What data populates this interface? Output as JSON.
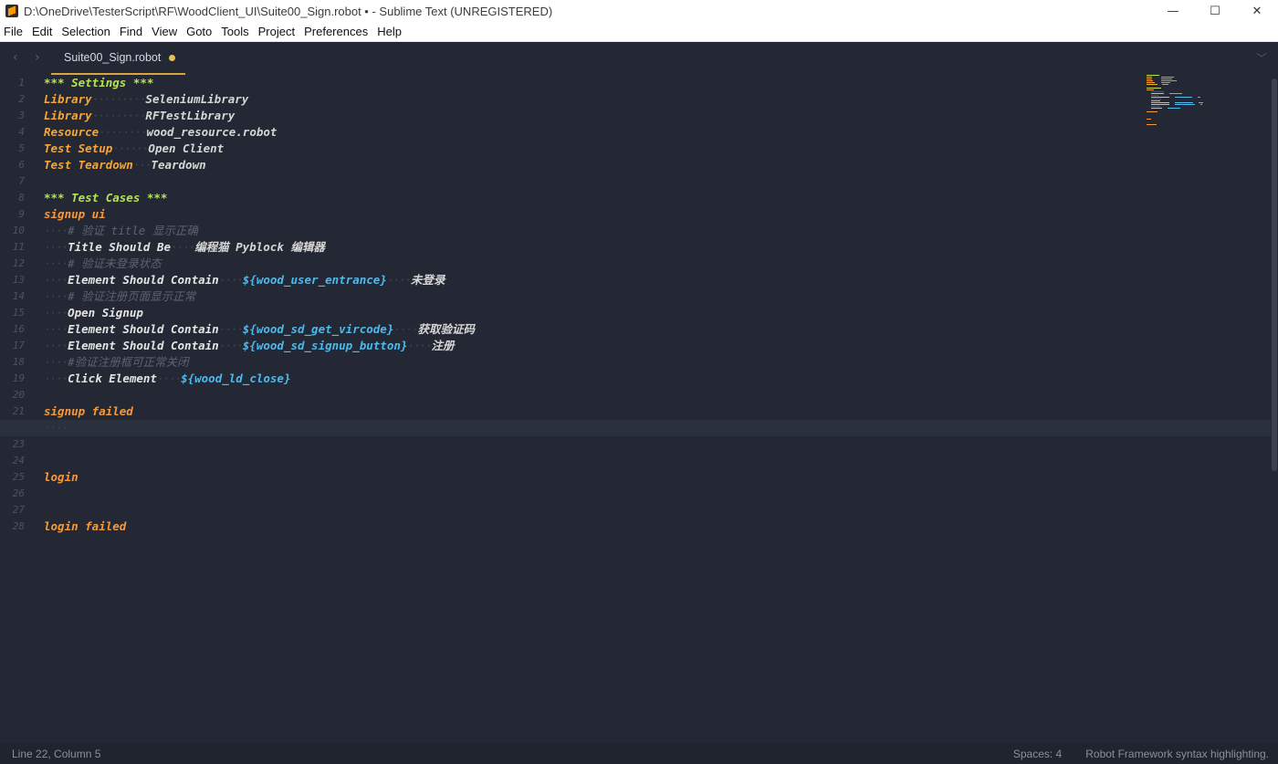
{
  "window": {
    "title": "D:\\OneDrive\\TesterScript\\RF\\WoodClient_UI\\Suite00_Sign.robot • - Sublime Text (UNREGISTERED)",
    "minimize": "—",
    "maximize": "☐",
    "close": "✕"
  },
  "menu": [
    "File",
    "Edit",
    "Selection",
    "Find",
    "View",
    "Goto",
    "Tools",
    "Project",
    "Preferences",
    "Help"
  ],
  "tab": {
    "label": "Suite00_Sign.robot",
    "dirty_color": "#e8c156",
    "accent_color": "#d9a441"
  },
  "nav": {
    "back": "‹",
    "forward": "›",
    "tab_menu": "﹀"
  },
  "editor": {
    "line_numbers": [
      "1",
      "2",
      "3",
      "4",
      "5",
      "6",
      "7",
      "8",
      "9",
      "10",
      "11",
      "12",
      "13",
      "14",
      "15",
      "16",
      "17",
      "18",
      "19",
      "20",
      "21",
      "22",
      "23",
      "24",
      "25",
      "26",
      "27",
      "28"
    ],
    "current_line": 22,
    "lines": [
      [
        {
          "c": "hdr",
          "t": "*** Settings ***"
        }
      ],
      [
        {
          "c": "setk",
          "t": "Library"
        },
        {
          "c": "dots",
          "t": "·········"
        },
        {
          "c": "val",
          "t": "SeleniumLibrary"
        }
      ],
      [
        {
          "c": "setk",
          "t": "Library"
        },
        {
          "c": "dots",
          "t": "·········"
        },
        {
          "c": "val",
          "t": "RFTestLibrary"
        }
      ],
      [
        {
          "c": "setk",
          "t": "Resource"
        },
        {
          "c": "dots",
          "t": "········"
        },
        {
          "c": "val",
          "t": "wood_resource.robot"
        }
      ],
      [
        {
          "c": "setk",
          "t": "Test Setup"
        },
        {
          "c": "dots",
          "t": "······"
        },
        {
          "c": "val",
          "t": "Open Client"
        }
      ],
      [
        {
          "c": "setk",
          "t": "Test Teardown"
        },
        {
          "c": "dots",
          "t": "···"
        },
        {
          "c": "val",
          "t": "Teardown"
        }
      ],
      [],
      [
        {
          "c": "hdr",
          "t": "*** Test Cases ***"
        }
      ],
      [
        {
          "c": "tc",
          "t": "signup ui"
        }
      ],
      [
        {
          "c": "dots",
          "t": "····"
        },
        {
          "c": "cmt",
          "t": "# 验证 title 显示正确"
        }
      ],
      [
        {
          "c": "dots",
          "t": "····"
        },
        {
          "c": "kw",
          "t": "Title Should Be"
        },
        {
          "c": "dots",
          "t": "····"
        },
        {
          "c": "arg",
          "t": "编程猫 Pyblock 编辑器"
        }
      ],
      [
        {
          "c": "dots",
          "t": "····"
        },
        {
          "c": "cmt",
          "t": "# 验证未登录状态"
        }
      ],
      [
        {
          "c": "dots",
          "t": "····"
        },
        {
          "c": "kw",
          "t": "Element Should Contain"
        },
        {
          "c": "dots",
          "t": "····"
        },
        {
          "c": "var",
          "t": "${wood_user_entrance}"
        },
        {
          "c": "dots",
          "t": "····"
        },
        {
          "c": "arg",
          "t": "未登录"
        }
      ],
      [
        {
          "c": "dots",
          "t": "····"
        },
        {
          "c": "cmt",
          "t": "# 验证注册页面显示正常"
        }
      ],
      [
        {
          "c": "dots",
          "t": "····"
        },
        {
          "c": "kw",
          "t": "Open Signup"
        }
      ],
      [
        {
          "c": "dots",
          "t": "····"
        },
        {
          "c": "kw",
          "t": "Element Should Contain"
        },
        {
          "c": "dots",
          "t": "····"
        },
        {
          "c": "var",
          "t": "${wood_sd_get_vircode}"
        },
        {
          "c": "dots",
          "t": "····"
        },
        {
          "c": "arg",
          "t": "获取验证码"
        }
      ],
      [
        {
          "c": "dots",
          "t": "····"
        },
        {
          "c": "kw",
          "t": "Element Should Contain"
        },
        {
          "c": "dots",
          "t": "····"
        },
        {
          "c": "var",
          "t": "${wood_sd_signup_button}"
        },
        {
          "c": "dots",
          "t": "····"
        },
        {
          "c": "arg",
          "t": "注册"
        }
      ],
      [
        {
          "c": "dots",
          "t": "····"
        },
        {
          "c": "cmt",
          "t": "#验证注册框可正常关闭"
        }
      ],
      [
        {
          "c": "dots",
          "t": "····"
        },
        {
          "c": "kw",
          "t": "Click Element"
        },
        {
          "c": "dots",
          "t": "····"
        },
        {
          "c": "var",
          "t": "${wood_ld_close}"
        }
      ],
      [],
      [
        {
          "c": "tc",
          "t": "signup failed"
        }
      ],
      [
        {
          "c": "dots",
          "t": "····"
        }
      ],
      [],
      [],
      [
        {
          "c": "tc",
          "t": "login"
        }
      ],
      [],
      [],
      [
        {
          "c": "tc",
          "t": "login failed"
        }
      ]
    ]
  },
  "status": {
    "position": "Line 22, Column 5",
    "indent": "Spaces: 4",
    "syntax": "Robot Framework syntax highlighting."
  }
}
